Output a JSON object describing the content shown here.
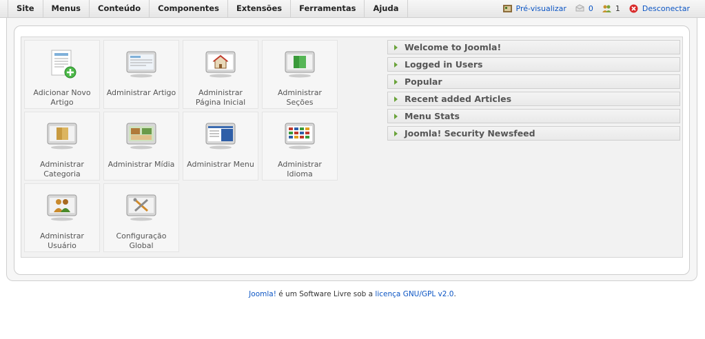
{
  "menu": {
    "items": [
      "Site",
      "Menus",
      "Conteúdo",
      "Componentes",
      "Extensões",
      "Ferramentas",
      "Ajuda"
    ]
  },
  "status": {
    "preview_label": "Pré-visualizar",
    "messages_count": "0",
    "users_count": "1",
    "logout_label": "Desconectar"
  },
  "cpanel": {
    "icons": [
      {
        "label": "Adicionar Novo Artigo",
        "icon": "add-article-icon"
      },
      {
        "label": "Administrar Artigo",
        "icon": "article-icon"
      },
      {
        "label": "Administrar Página Inicial",
        "icon": "frontpage-icon"
      },
      {
        "label": "Administrar Seções",
        "icon": "sections-icon"
      },
      {
        "label": "Administrar Categoria",
        "icon": "category-icon"
      },
      {
        "label": "Administrar Mídia",
        "icon": "media-icon"
      },
      {
        "label": "Administrar Menu",
        "icon": "menu-icon"
      },
      {
        "label": "Administrar Idioma",
        "icon": "language-icon"
      },
      {
        "label": "Administrar Usuário",
        "icon": "user-icon"
      },
      {
        "label": "Configuração Global",
        "icon": "config-icon"
      }
    ]
  },
  "accordion": {
    "panels": [
      "Welcome to Joomla!",
      "Logged in Users",
      "Popular",
      "Recent added Articles",
      "Menu Stats",
      "Joomla! Security Newsfeed"
    ]
  },
  "footer": {
    "link1": "Joomla!",
    "text": " é um Software Livre sob a ",
    "link2": "licença GNU/GPL v2.0",
    "end": "."
  },
  "colors": {
    "link": "#0b55c4",
    "accordion_arrow": "#6aa33a"
  }
}
